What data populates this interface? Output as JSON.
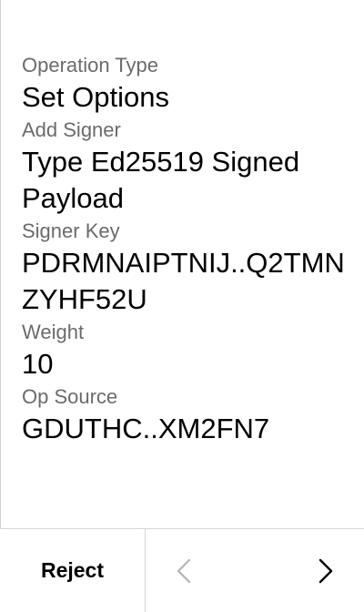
{
  "fields": [
    {
      "label": "Operation Type",
      "value": "Set Options"
    },
    {
      "label": "Add Signer",
      "value": "Type Ed25519 Signed Payload"
    },
    {
      "label": "Signer Key",
      "value": "PDRMNAIPTNIJ..Q2TMNZYHF52U"
    },
    {
      "label": "Weight",
      "value": "10"
    },
    {
      "label": "Op Source",
      "value": "GDUTHC..XM2FN7"
    }
  ],
  "footer": {
    "reject_label": "Reject",
    "prev_icon": "chevron-left-icon",
    "next_icon": "chevron-right-icon",
    "prev_enabled": false,
    "next_enabled": true
  },
  "colors": {
    "label": "#6b6b6b",
    "value": "#000000",
    "divider": "#d6d6d6",
    "disabled": "#b5b5b5"
  }
}
